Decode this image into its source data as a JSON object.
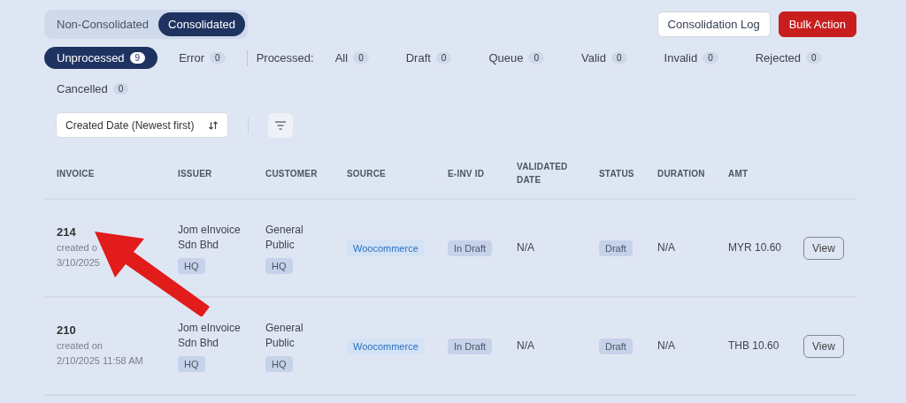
{
  "view_toggle": [
    {
      "label": "Non-Consolidated",
      "selected": false
    },
    {
      "label": "Consolidated",
      "selected": true
    }
  ],
  "header_buttons": [
    {
      "label": "Consolidation Log",
      "kind": "outline"
    },
    {
      "label": "Bulk Action",
      "kind": "danger"
    }
  ],
  "primary_filters": [
    {
      "label": "Unprocessed",
      "count": "9",
      "selected": true
    },
    {
      "label": "Error",
      "count": "0",
      "selected": false
    }
  ],
  "processed_label": "Processed:",
  "processed_filters": [
    {
      "label": "All",
      "count": "0",
      "selected": false
    },
    {
      "label": "Draft",
      "count": "0",
      "selected": false
    },
    {
      "label": "Queue",
      "count": "0",
      "selected": false
    },
    {
      "label": "Valid",
      "count": "0",
      "selected": false
    },
    {
      "label": "Invalid",
      "count": "0",
      "selected": false
    },
    {
      "label": "Rejected",
      "count": "0",
      "selected": false
    },
    {
      "label": "Cancelled",
      "count": "0",
      "selected": false
    }
  ],
  "sort": {
    "value": "Created Date (Newest first)"
  },
  "table": {
    "columns": [
      "INVOICE",
      "ISSUER",
      "CUSTOMER",
      "SOURCE",
      "E-INV ID",
      "VALIDATED DATE",
      "STATUS",
      "DURATION",
      "AMT"
    ],
    "rows": [
      {
        "invoice": "214",
        "created_label": "created o",
        "created_date": "3/10/2025",
        "issuer": "Jom eInvoice Sdn Bhd",
        "issuer_tag": "HQ",
        "customer": "General Public",
        "customer_tag": "HQ",
        "source": "Woocommerce",
        "einv_id": "In Draft",
        "validated_date": "N/A",
        "status": "Draft",
        "duration": "N/A",
        "amount": "MYR 10.60",
        "action": "View"
      },
      {
        "invoice": "210",
        "created_label": "created on",
        "created_date": "2/10/2025 11:58 AM",
        "issuer": "Jom eInvoice Sdn Bhd",
        "issuer_tag": "HQ",
        "customer": "General Public",
        "customer_tag": "HQ",
        "source": "Woocommerce",
        "einv_id": "In Draft",
        "validated_date": "N/A",
        "status": "Draft",
        "duration": "N/A",
        "amount": "THB 10.60",
        "action": "View"
      }
    ]
  }
}
